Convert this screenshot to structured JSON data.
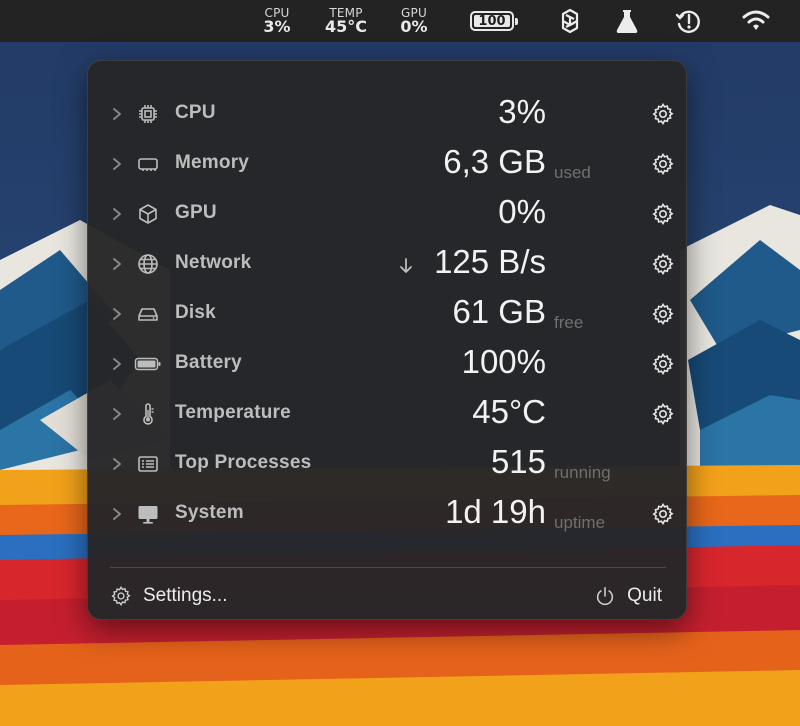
{
  "menubar": {
    "cpu": {
      "label": "CPU",
      "value": "3%"
    },
    "temp": {
      "label": "TEMP",
      "value": "45°C"
    },
    "gpu": {
      "label": "GPU",
      "value": "0%"
    },
    "battery": "100",
    "icons": [
      "chatgpt-icon",
      "flask-icon",
      "time-machine-icon",
      "wifi-icon"
    ]
  },
  "panel": {
    "rows": [
      {
        "label": "CPU",
        "value": "3%",
        "unit": "",
        "icon": "cpu-chip-icon"
      },
      {
        "label": "Memory",
        "value": "6,3 GB",
        "unit": "used",
        "icon": "memory-icon"
      },
      {
        "label": "GPU",
        "value": "0%",
        "unit": "",
        "icon": "gpu-cube-icon"
      },
      {
        "label": "Network",
        "value": "125 B/s",
        "unit": "",
        "icon": "globe-icon"
      },
      {
        "label": "Disk",
        "value": "61 GB",
        "unit": "free",
        "icon": "disk-icon"
      },
      {
        "label": "Battery",
        "value": "100%",
        "unit": "",
        "icon": "battery-icon"
      },
      {
        "label": "Temperature",
        "value": "45°C",
        "unit": "",
        "icon": "thermometer-icon"
      },
      {
        "label": "Top Processes",
        "value": "515",
        "unit": "running",
        "icon": "process-list-icon"
      },
      {
        "label": "System",
        "value": "1d 19h",
        "unit": "uptime",
        "icon": "monitor-icon"
      }
    ],
    "footer": {
      "settings_label": "Settings...",
      "quit_label": "Quit"
    }
  },
  "colors": {
    "panel_bg": "#262628",
    "menubar_bg": "#232323",
    "label": "#bdbdbd",
    "value": "#f2f2f2",
    "unit": "#6f6f6f"
  }
}
